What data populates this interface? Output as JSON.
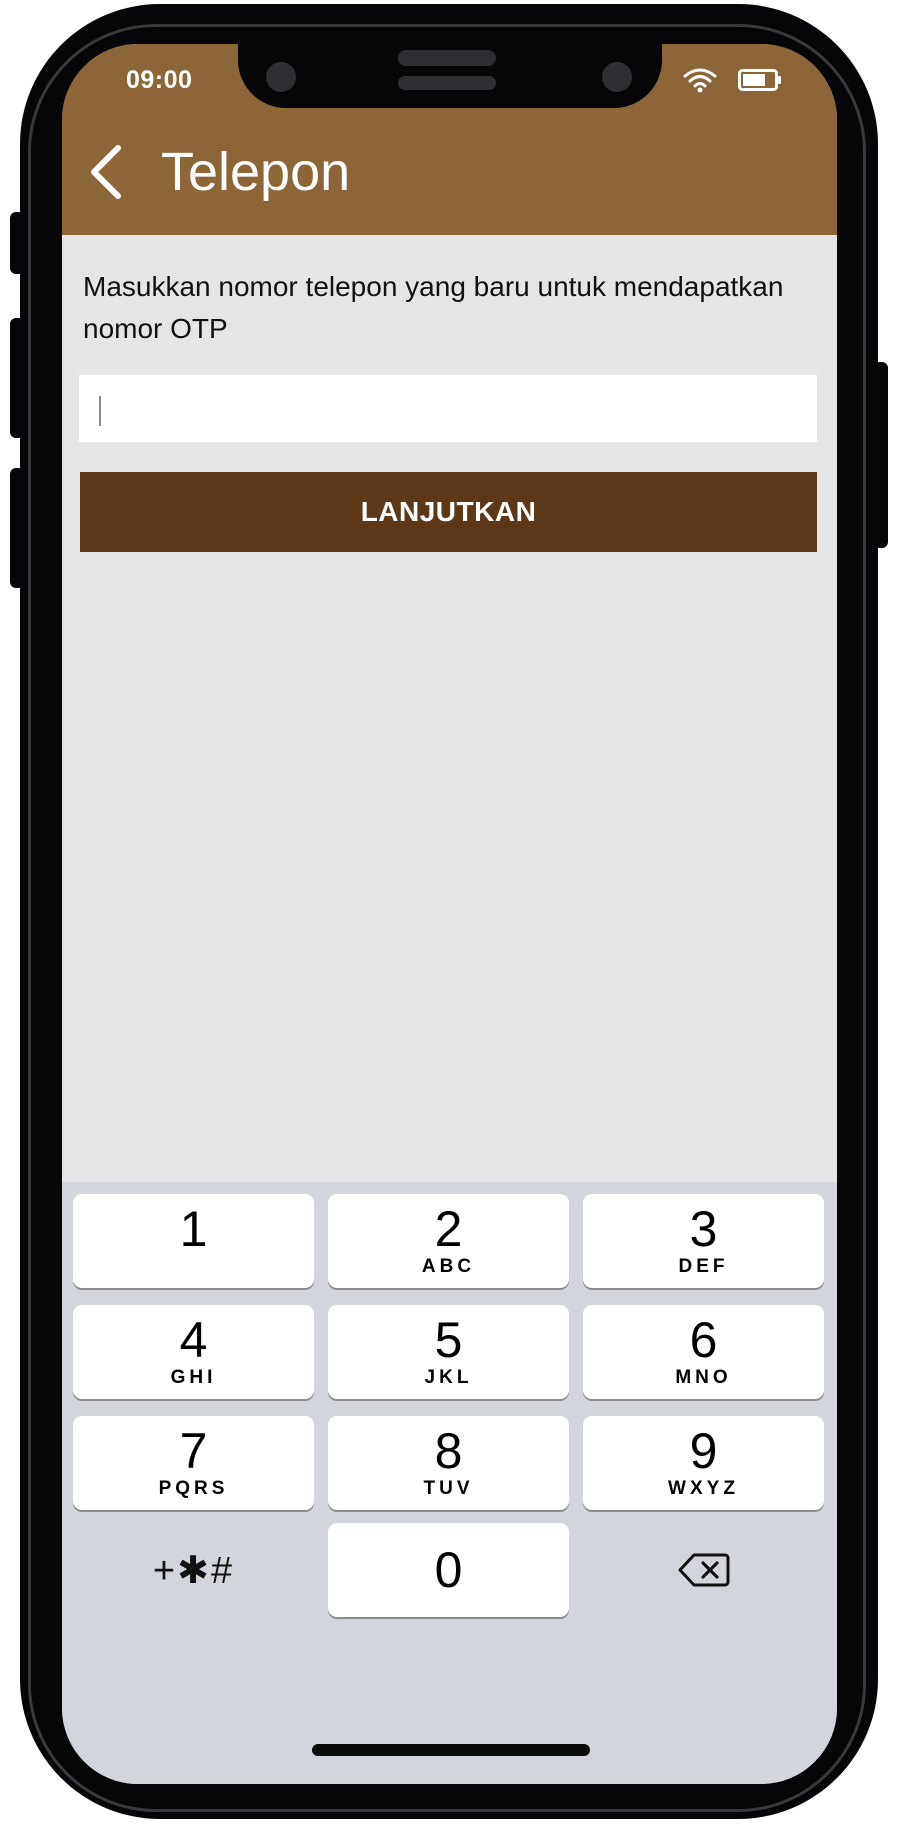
{
  "status_bar": {
    "time": "09:00",
    "wifi_icon": "wifi-icon",
    "battery_icon": "battery-icon"
  },
  "header": {
    "back_icon": "chevron-left-icon",
    "title": "Telepon",
    "background_color": "#8c6637"
  },
  "form": {
    "instruction": "Masukkan nomor telepon yang baru untuk mendapatkan nomor OTP",
    "phone_value": "",
    "continue_label": "LANJUTKAN",
    "button_color": "#5c3818"
  },
  "keyboard": {
    "keys": [
      {
        "digit": "1",
        "letters": ""
      },
      {
        "digit": "2",
        "letters": "ABC"
      },
      {
        "digit": "3",
        "letters": "DEF"
      },
      {
        "digit": "4",
        "letters": "GHI"
      },
      {
        "digit": "5",
        "letters": "JKL"
      },
      {
        "digit": "6",
        "letters": "MNO"
      },
      {
        "digit": "7",
        "letters": "PQRS"
      },
      {
        "digit": "8",
        "letters": "TUV"
      },
      {
        "digit": "9",
        "letters": "WXYZ"
      },
      {
        "digit": "0",
        "letters": ""
      }
    ],
    "symbols_label": "+✱#",
    "delete_icon": "backspace-icon"
  }
}
